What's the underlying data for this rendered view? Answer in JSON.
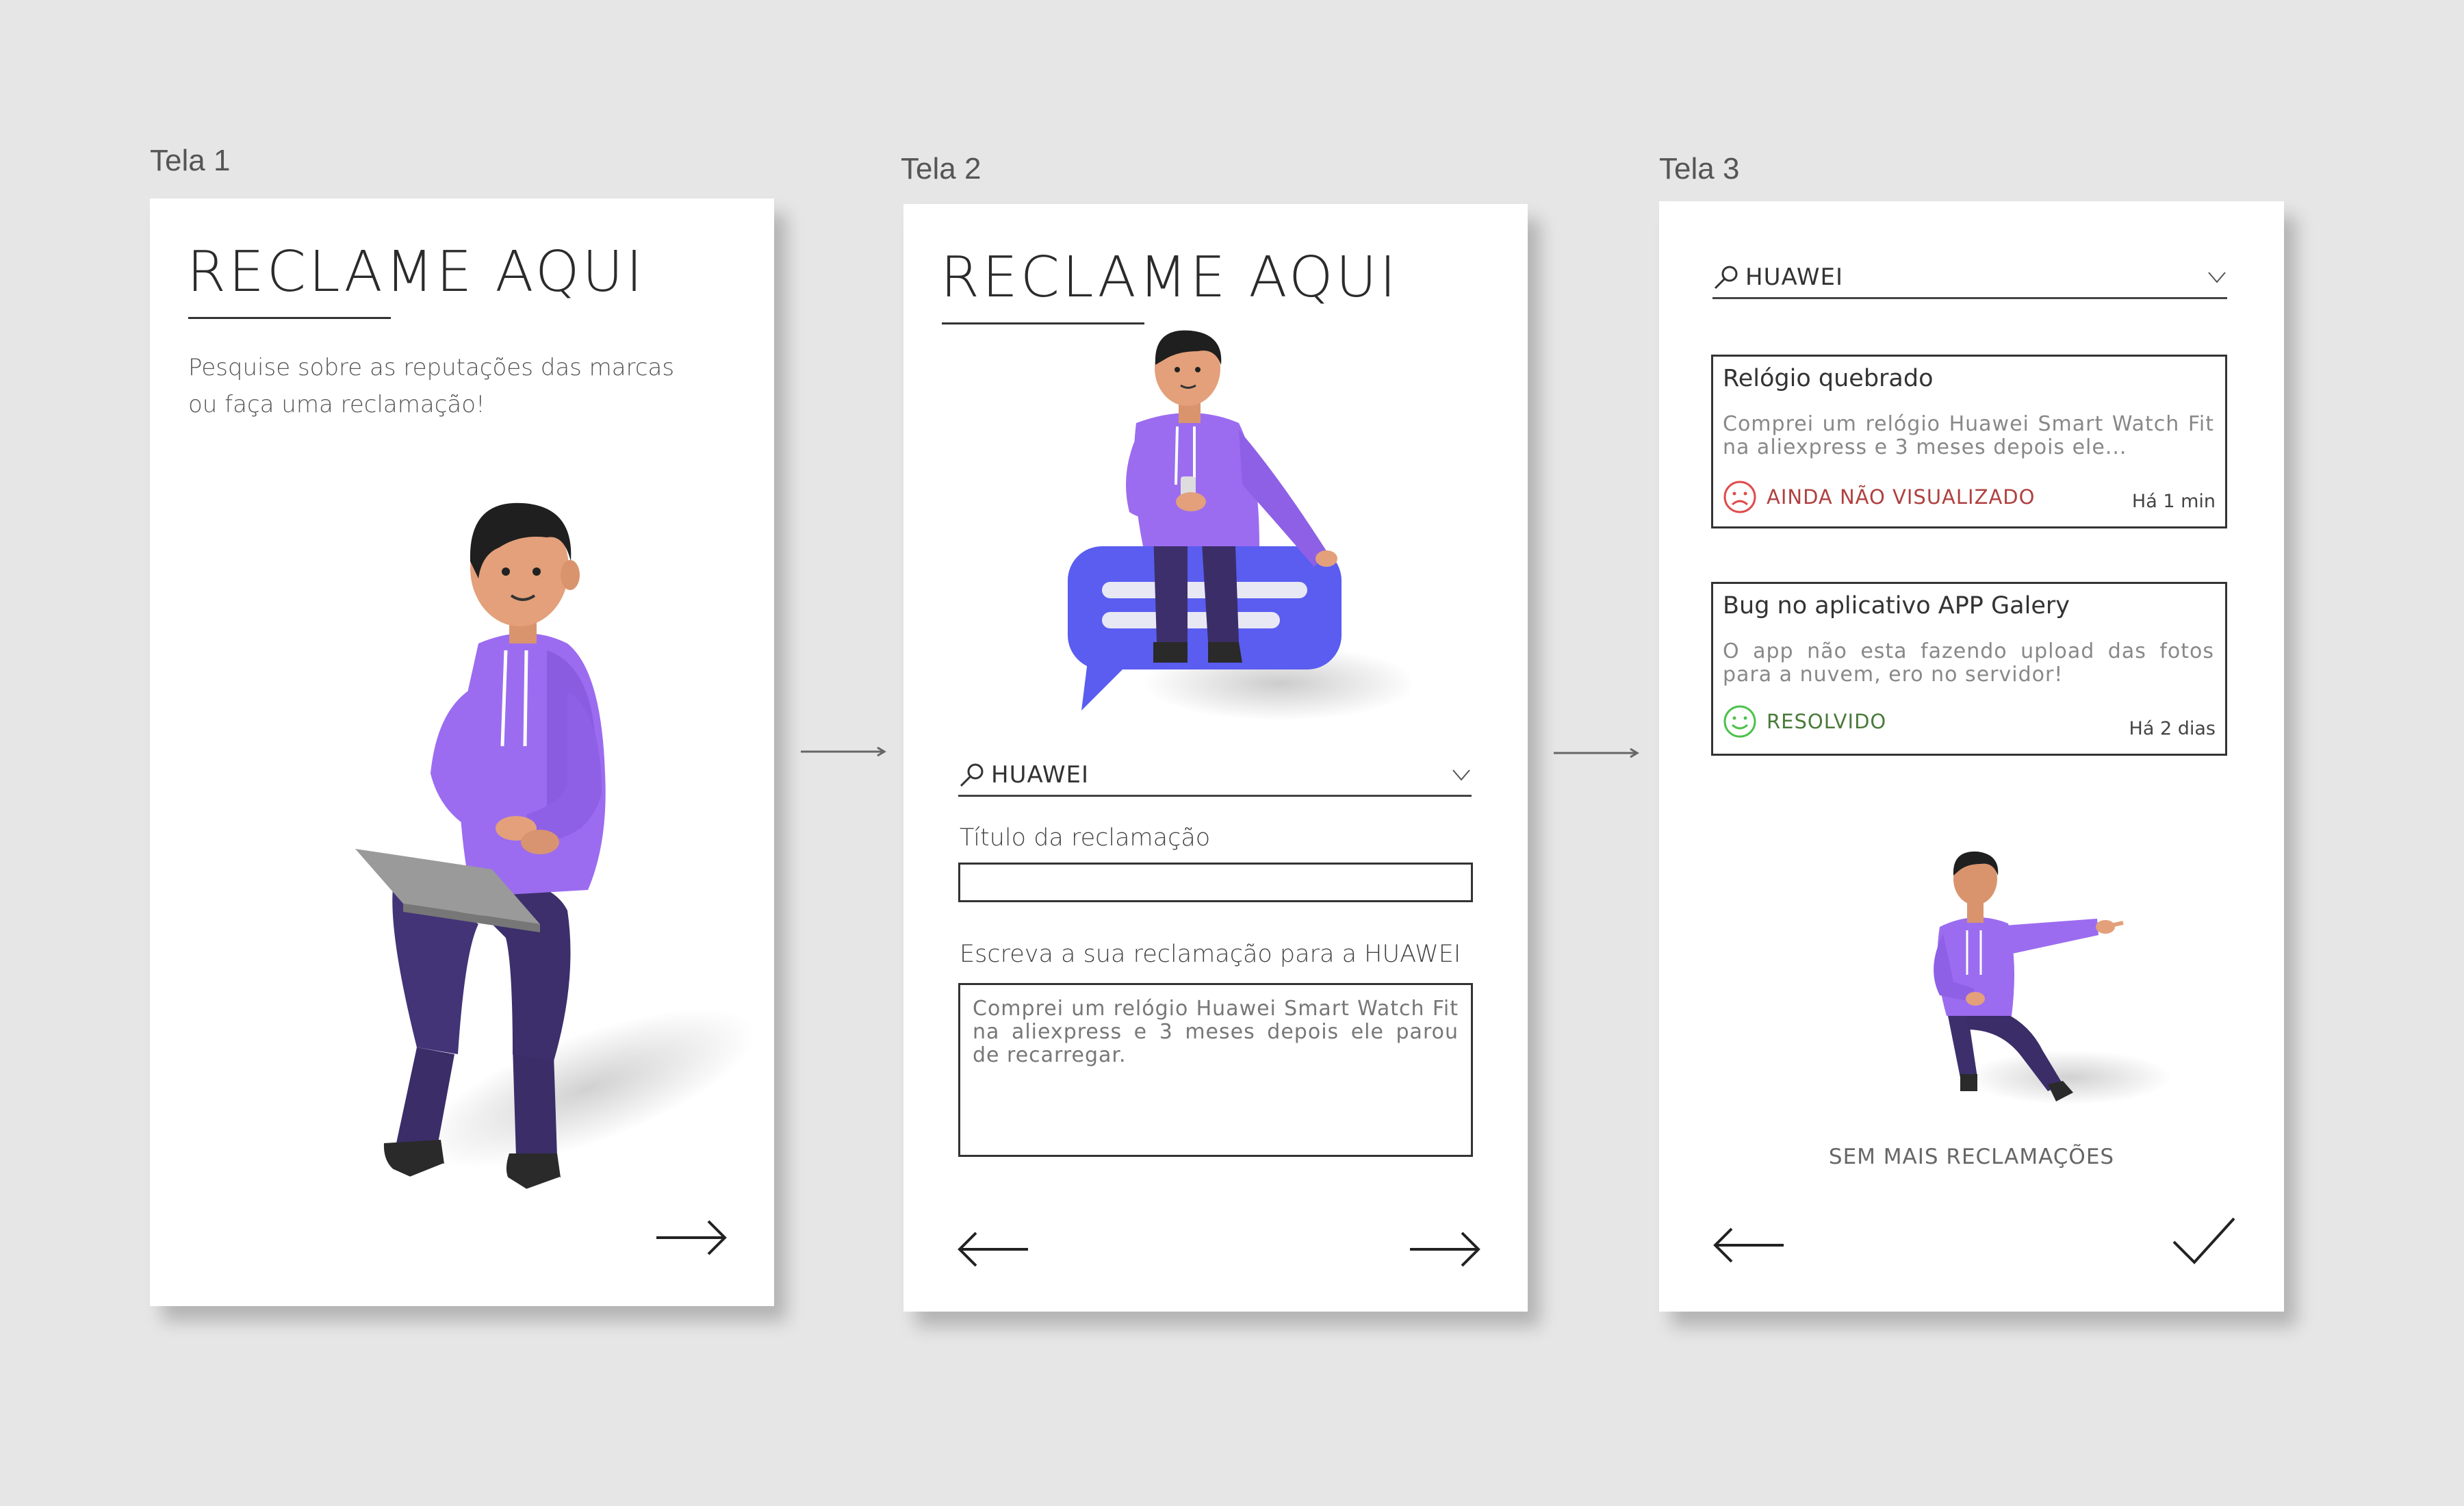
{
  "screens": [
    {
      "label": "Tela 1",
      "brand": "RECLAME AQUI",
      "intro_line1": "Pesquise sobre as reputações das marcas",
      "intro_line2": "ou faça uma reclamação!"
    },
    {
      "label": "Tela 2",
      "brand": "RECLAME AQUI",
      "search_value": "HUAWEI",
      "title_label": "Título da reclamação",
      "title_value": "",
      "complaint_label": "Escreva a sua reclamação para a HUAWEI",
      "complaint_value": "Comprei um relógio Huawei Smart Watch Fit na aliexpress e 3 meses depois ele parou de recarregar."
    },
    {
      "label": "Tela 3",
      "search_value": "HUAWEI",
      "complaints": [
        {
          "title": "Relógio quebrado",
          "desc": "Comprei um relógio Huawei Smart Watch Fit na aliexpress e 3 meses depois ele...",
          "status": "AINDA NÃO VISUALIZADO",
          "time": "Há 1 min",
          "status_icon": "sad-face-icon"
        },
        {
          "title": "Bug no aplicativo APP Galery",
          "desc": "O app não esta fazendo upload das fotos para a nuvem, ero no servidor!",
          "status": "RESOLVIDO",
          "time": "Há 2 dias",
          "status_icon": "happy-face-icon"
        }
      ],
      "empty_text": "SEM MAIS RECLAMAÇÕES"
    }
  ],
  "colors": {
    "background": "#e6e6e6",
    "purple": "#9b6cf0",
    "pants": "#3d2f6b",
    "bubble": "#5a5df0",
    "status_unseen": "#e04b4b",
    "status_resolved": "#4cc24c"
  }
}
